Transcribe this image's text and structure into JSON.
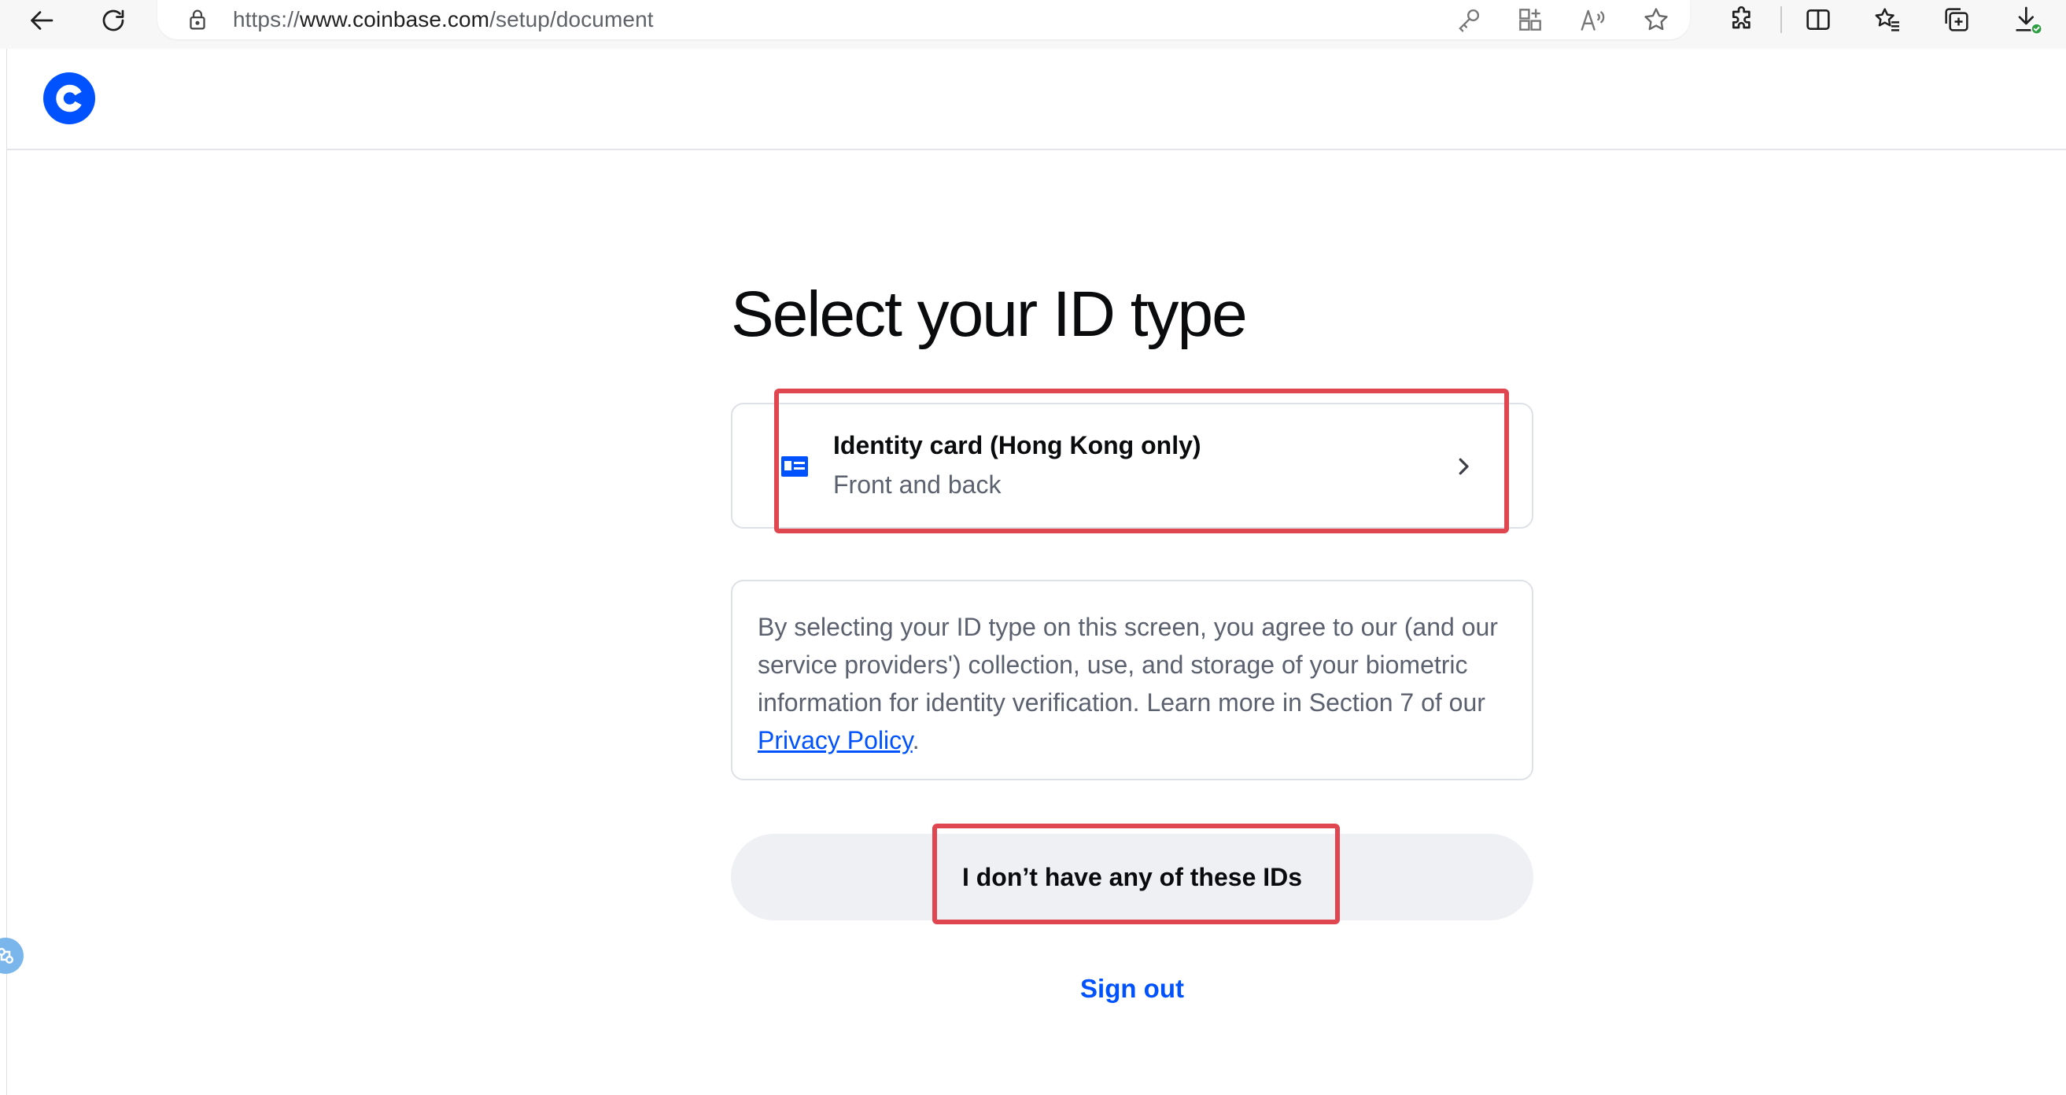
{
  "browser": {
    "url_prefix": "https://",
    "url_host": "www.coinbase.com",
    "url_path": "/setup/document"
  },
  "page": {
    "title": "Select your ID type",
    "id_option": {
      "title": "Identity card (Hong Kong only)",
      "subtitle": "Front and back"
    },
    "consent": {
      "text_before_link": "By selecting your ID type on this screen, you agree to our (and our service providers') collection, use, and storage of your biometric information for identity verification. Learn more in Section 7 of our ",
      "link_text": "Privacy Policy",
      "text_after_link": "."
    },
    "no_id_button": "I don’t have any of these IDs",
    "sign_out": "Sign out"
  },
  "colors": {
    "brand_blue": "#0052ff",
    "highlight_red": "#e0464f"
  },
  "icons": [
    "back-arrow-icon",
    "reload-icon",
    "lock-icon",
    "key-icon",
    "app-grid-icon",
    "read-aloud-icon",
    "favorite-star-icon",
    "extensions-icon",
    "split-screen-icon",
    "favorites-icon",
    "collections-icon",
    "downloads-icon",
    "coinbase-logo",
    "id-card-icon",
    "chevron-right-icon"
  ]
}
